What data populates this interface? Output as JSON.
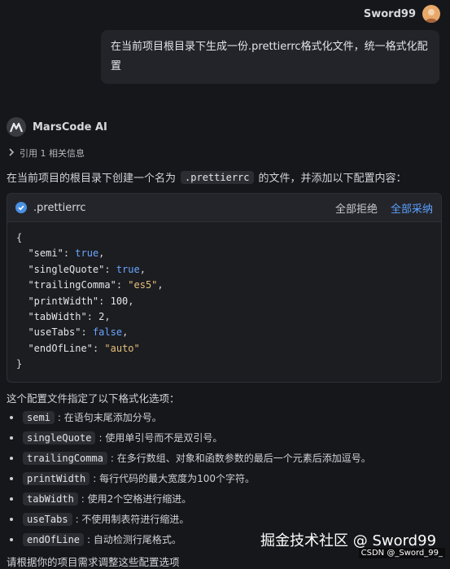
{
  "user": {
    "name": "Sword99",
    "message": "在当前项目根目录下生成一份.prettierrc格式化文件，统一格式化配置"
  },
  "assistant": {
    "name": "MarsCode AI",
    "reference": "引用 1 相关信息",
    "intro_before": "在当前项目的根目录下创建一个名为",
    "intro_code": ".prettierrc",
    "intro_after": "的文件，并添加以下配置内容：",
    "code_block": {
      "filename": ".prettierrc",
      "reject_label": "全部拒绝",
      "accept_label": "全部采纳",
      "lines": [
        {
          "open": "{"
        },
        {
          "key": "\"semi\"",
          "value": "true",
          "type": "bool"
        },
        {
          "key": "\"singleQuote\"",
          "value": "true",
          "type": "bool"
        },
        {
          "key": "\"trailingComma\"",
          "value": "\"es5\"",
          "type": "str"
        },
        {
          "key": "\"printWidth\"",
          "value": "100",
          "type": "num"
        },
        {
          "key": "\"tabWidth\"",
          "value": "2",
          "type": "num"
        },
        {
          "key": "\"useTabs\"",
          "value": "false",
          "type": "bool"
        },
        {
          "key": "\"endOfLine\"",
          "value": "\"auto\"",
          "type": "str",
          "last": true
        },
        {
          "close": "}"
        }
      ]
    },
    "summary": "这个配置文件指定了以下格式化选项：",
    "options": [
      {
        "name": "semi",
        "desc": ": 在语句末尾添加分号。"
      },
      {
        "name": "singleQuote",
        "desc": ": 使用单引号而不是双引号。"
      },
      {
        "name": "trailingComma",
        "desc": ": 在多行数组、对象和函数参数的最后一个元素后添加逗号。"
      },
      {
        "name": "printWidth",
        "desc": ": 每行代码的最大宽度为100个字符。"
      },
      {
        "name": "tabWidth",
        "desc": ": 使用2个空格进行缩进。"
      },
      {
        "name": "useTabs",
        "desc": ": 不使用制表符进行缩进。"
      },
      {
        "name": "endOfLine",
        "desc": ": 自动检测行尾格式。"
      }
    ],
    "trailing": "请根据你的项目需求调整这些配置选项"
  },
  "watermark": {
    "main": "掘金技术社区 @ Sword99",
    "small": "CSDN @_Sword_99_"
  },
  "colors": {
    "accent": "#5aa0ff",
    "avatar": "#e8a86a",
    "background": "#16171b"
  },
  "icons": {
    "avatar": "avatar-icon",
    "logo": "marscode-logo-icon",
    "chevron": "chevron-right-icon",
    "check": "check-icon"
  }
}
